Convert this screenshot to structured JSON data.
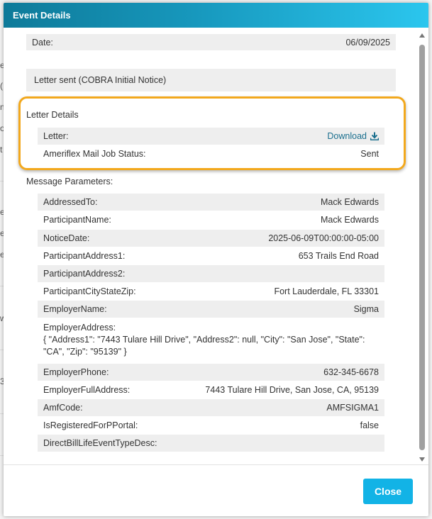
{
  "modal": {
    "title": "Event Details",
    "close_label": "Close"
  },
  "background_fragments": [
    "e",
    "(I",
    "nt",
    "op",
    "t",
    "e",
    "e",
    "er",
    "w",
    "3"
  ],
  "event": {
    "date_label": "Date:",
    "date_value": "06/09/2025",
    "letter_sent": "Letter sent (COBRA Initial Notice)"
  },
  "letter_details": {
    "heading": "Letter Details",
    "letter_label": "Letter:",
    "download_label": "Download",
    "download_icon": "download-icon",
    "status_label": "Ameriflex Mail Job Status:",
    "status_value": "Sent"
  },
  "message_parameters": {
    "heading": "Message Parameters:",
    "items": [
      {
        "label": "AddressedTo:",
        "value": "Mack Edwards"
      },
      {
        "label": "ParticipantName:",
        "value": "Mack Edwards"
      },
      {
        "label": "NoticeDate:",
        "value": "2025-06-09T00:00:00-05:00"
      },
      {
        "label": "ParticipantAddress1:",
        "value": "653 Trails End Road"
      },
      {
        "label": "ParticipantAddress2:",
        "value": ""
      },
      {
        "label": "ParticipantCityStateZip:",
        "value": "Fort Lauderdale, FL 33301"
      },
      {
        "label": "EmployerName:",
        "value": "Sigma"
      }
    ],
    "employer_address_label": "EmployerAddress:",
    "employer_address_value": "{ \"Address1\": \"7443 Tulare Hill Drive\", \"Address2\": null, \"City\": \"San Jose\", \"State\": \"CA\", \"Zip\": \"95139\" }",
    "items_after": [
      {
        "label": "EmployerPhone:",
        "value": "632-345-6678"
      },
      {
        "label": "EmployerFullAddress:",
        "value": "7443 Tulare Hill Drive, San Jose, CA, 95139"
      },
      {
        "label": "AmfCode:",
        "value": "AMFSIGMA1"
      },
      {
        "label": "IsRegisteredForPPortal:",
        "value": "false"
      },
      {
        "label": "DirectBillLifeEventTypeDesc:",
        "value": ""
      }
    ]
  },
  "colors": {
    "header_start": "#0e7a99",
    "header_end": "#2bc6ee",
    "highlight": "#f2a81d",
    "close_button": "#12b3e6",
    "link": "#1a6f8e"
  }
}
